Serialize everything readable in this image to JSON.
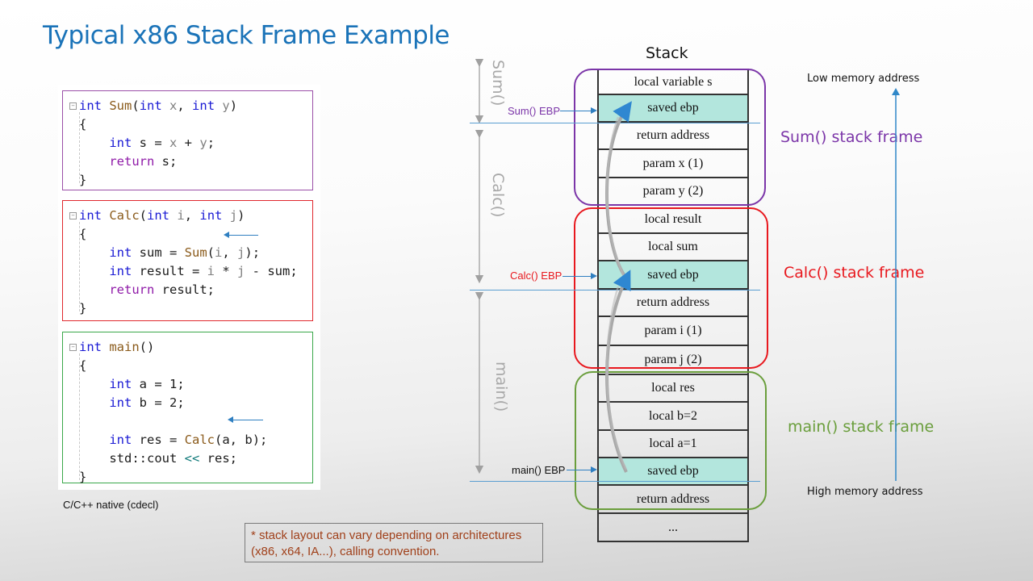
{
  "title": "Typical x86 Stack Frame Example",
  "code": {
    "caption": "C/C++ native (cdecl)",
    "blocks": [
      {
        "name": "sum",
        "border_color": "#9b4fa8",
        "lines": [
          [
            {
              "t": "int",
              "c": "kw"
            },
            {
              "t": " "
            },
            {
              "t": "Sum",
              "c": "fn"
            },
            {
              "t": "(",
              "c": "var"
            },
            {
              "t": "int",
              "c": "kw"
            },
            {
              "t": " "
            },
            {
              "t": "x",
              "c": "param"
            },
            {
              "t": ", ",
              "c": "var"
            },
            {
              "t": "int",
              "c": "kw"
            },
            {
              "t": " "
            },
            {
              "t": "y",
              "c": "param"
            },
            {
              "t": ")",
              "c": "var"
            }
          ],
          [
            {
              "t": "{",
              "c": "var"
            }
          ],
          [
            {
              "t": "    "
            },
            {
              "t": "int",
              "c": "kw"
            },
            {
              "t": " s = ",
              "c": "var"
            },
            {
              "t": "x",
              "c": "param"
            },
            {
              "t": " + ",
              "c": "var"
            },
            {
              "t": "y",
              "c": "param"
            },
            {
              "t": ";",
              "c": "var"
            }
          ],
          [
            {
              "t": "    "
            },
            {
              "t": "return",
              "c": "ret"
            },
            {
              "t": " s;",
              "c": "var"
            }
          ],
          [
            {
              "t": "}",
              "c": "var"
            }
          ]
        ]
      },
      {
        "name": "calc",
        "border_color": "#e0282e",
        "lines": [
          [
            {
              "t": "int",
              "c": "kw"
            },
            {
              "t": " "
            },
            {
              "t": "Calc",
              "c": "fn"
            },
            {
              "t": "(",
              "c": "var"
            },
            {
              "t": "int",
              "c": "kw"
            },
            {
              "t": " "
            },
            {
              "t": "i",
              "c": "param"
            },
            {
              "t": ", ",
              "c": "var"
            },
            {
              "t": "int",
              "c": "kw"
            },
            {
              "t": " "
            },
            {
              "t": "j",
              "c": "param"
            },
            {
              "t": ")",
              "c": "var"
            }
          ],
          [
            {
              "t": "{",
              "c": "var"
            }
          ],
          [
            {
              "t": "    "
            },
            {
              "t": "int",
              "c": "kw"
            },
            {
              "t": " sum = ",
              "c": "var"
            },
            {
              "t": "Sum",
              "c": "fn"
            },
            {
              "t": "(",
              "c": "var"
            },
            {
              "t": "i",
              "c": "param"
            },
            {
              "t": ", ",
              "c": "var"
            },
            {
              "t": "j",
              "c": "param"
            },
            {
              "t": ");",
              "c": "var"
            }
          ],
          [
            {
              "t": "    "
            },
            {
              "t": "int",
              "c": "kw"
            },
            {
              "t": " result = ",
              "c": "var"
            },
            {
              "t": "i",
              "c": "param"
            },
            {
              "t": " * ",
              "c": "var"
            },
            {
              "t": "j",
              "c": "param"
            },
            {
              "t": " - sum;",
              "c": "var"
            }
          ],
          [
            {
              "t": "    "
            },
            {
              "t": "return",
              "c": "ret"
            },
            {
              "t": " result;",
              "c": "var"
            }
          ],
          [
            {
              "t": "}",
              "c": "var"
            }
          ]
        ]
      },
      {
        "name": "main",
        "border_color": "#3aa84a",
        "lines": [
          [
            {
              "t": "int",
              "c": "kw"
            },
            {
              "t": " "
            },
            {
              "t": "main",
              "c": "fn"
            },
            {
              "t": "()",
              "c": "var"
            }
          ],
          [
            {
              "t": "{",
              "c": "var"
            }
          ],
          [
            {
              "t": "    "
            },
            {
              "t": "int",
              "c": "kw"
            },
            {
              "t": " a = 1;",
              "c": "var"
            }
          ],
          [
            {
              "t": "    "
            },
            {
              "t": "int",
              "c": "kw"
            },
            {
              "t": " b = 2;",
              "c": "var"
            }
          ],
          [
            {
              "t": ""
            }
          ],
          [
            {
              "t": "    "
            },
            {
              "t": "int",
              "c": "kw"
            },
            {
              "t": " res = ",
              "c": "var"
            },
            {
              "t": "Calc",
              "c": "fn"
            },
            {
              "t": "(",
              "c": "var"
            },
            {
              "t": "a",
              "c": "var"
            },
            {
              "t": ", ",
              "c": "var"
            },
            {
              "t": "b",
              "c": "var"
            },
            {
              "t": ");",
              "c": "var"
            }
          ],
          [
            {
              "t": "    "
            },
            {
              "t": "std::cout ",
              "c": "var"
            },
            {
              "t": "<<",
              "c": "op"
            },
            {
              "t": " res;",
              "c": "var"
            }
          ],
          [
            {
              "t": "}",
              "c": "var"
            }
          ]
        ]
      }
    ]
  },
  "note": "* stack layout can vary depending on architectures (x86, x64, IA...), calling convention.",
  "stack": {
    "title": "Stack",
    "cells": [
      {
        "label": "local variable s",
        "highlight": false
      },
      {
        "label": "saved ebp",
        "highlight": true
      },
      {
        "label": "return address",
        "highlight": false
      },
      {
        "label": "param x (1)",
        "highlight": false
      },
      {
        "label": "param y (2)",
        "highlight": false
      },
      {
        "label": "local result",
        "highlight": false
      },
      {
        "label": "local sum",
        "highlight": false
      },
      {
        "label": "saved ebp",
        "highlight": true
      },
      {
        "label": "return address",
        "highlight": false
      },
      {
        "label": "param i (1)",
        "highlight": false
      },
      {
        "label": "param j (2)",
        "highlight": false
      },
      {
        "label": "local res",
        "highlight": false
      },
      {
        "label": "local b=2",
        "highlight": false
      },
      {
        "label": "local a=1",
        "highlight": false
      },
      {
        "label": "saved ebp",
        "highlight": true
      },
      {
        "label": "return address",
        "highlight": false
      },
      {
        "label": "...",
        "highlight": false
      }
    ],
    "frames": [
      {
        "label": "Sum() stack frame",
        "color": "#7b35a8"
      },
      {
        "label": "Calc() stack frame",
        "color": "#e8181e"
      },
      {
        "label": "main() stack frame",
        "color": "#6a9e3c"
      }
    ],
    "ebp_labels": [
      {
        "label": "Sum() EBP",
        "color": "#7b35a8"
      },
      {
        "label": "Calc() EBP",
        "color": "#e8181e"
      },
      {
        "label": "main() EBP",
        "color": "#111111"
      }
    ],
    "ranges": [
      "Sum()",
      "Calc()",
      "main()"
    ],
    "low_memory_label": "Low memory address",
    "high_memory_label": "High memory address"
  }
}
